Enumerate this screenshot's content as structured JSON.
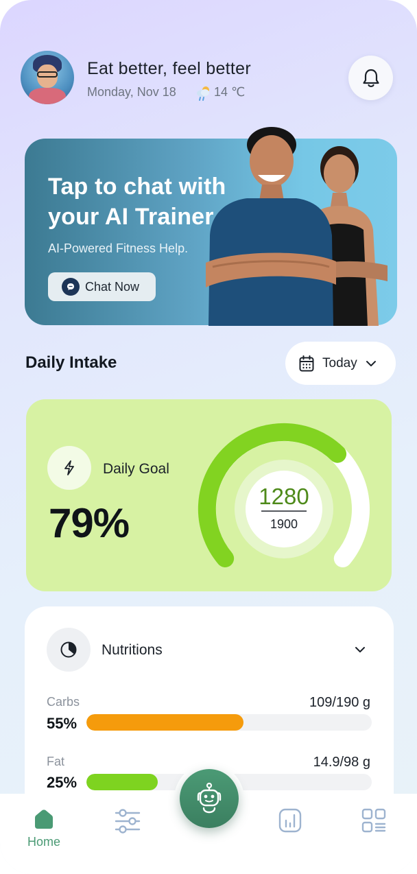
{
  "header": {
    "greeting": "Eat better, feel better",
    "date": "Monday, Nov 18",
    "temperature": "14 ℃",
    "weather_icon": "cloud-sun-rain-icon"
  },
  "banner": {
    "title": "Tap to chat with your AI Trainer",
    "subtitle": "AI-Powered Fitness Help.",
    "button_label": "Chat Now"
  },
  "daily_intake": {
    "title": "Daily Intake",
    "period": "Today",
    "goal_label": "Daily Goal",
    "goal_percent": "79%",
    "consumed": "1280",
    "target": "1900",
    "progress_fraction": 0.67
  },
  "nutrition": {
    "title": "Nutritions",
    "items": [
      {
        "name": "Carbs",
        "amount": "109/190 g",
        "percent": "55%",
        "fraction": 0.55,
        "color": "#f59b0c"
      },
      {
        "name": "Fat",
        "amount": "14.9/98 g",
        "percent": "25%",
        "fraction": 0.25,
        "color": "#7ed320"
      }
    ]
  },
  "nav": {
    "home_label": "Home",
    "active_color": "#4a9a74",
    "inactive_color": "#9db3cf"
  }
}
